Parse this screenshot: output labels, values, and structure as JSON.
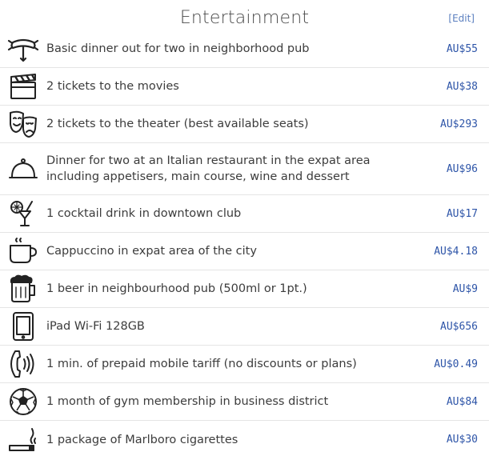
{
  "section": {
    "title": "Entertainment",
    "edit_label": "[Edit]"
  },
  "items": [
    {
      "icon": "sausage-icon",
      "label": "Basic dinner out for two in neighborhood pub",
      "price": "AU$55"
    },
    {
      "icon": "clapperboard-icon",
      "label": "2 tickets to the movies",
      "price": "AU$38"
    },
    {
      "icon": "theater-masks-icon",
      "label": "2 tickets to the theater (best available seats)",
      "price": "AU$293"
    },
    {
      "icon": "cloche-icon",
      "label": "Dinner for two at an Italian restaurant in the expat area including appetisers, main course, wine and dessert",
      "price": "AU$96"
    },
    {
      "icon": "cocktail-icon",
      "label": "1 cocktail drink in downtown club",
      "price": "AU$17"
    },
    {
      "icon": "coffee-cup-icon",
      "label": "Cappuccino in expat area of the city",
      "price": "AU$4.18"
    },
    {
      "icon": "beer-mug-icon",
      "label": "1 beer in neighbourhood pub (500ml or 1pt.)",
      "price": "AU$9"
    },
    {
      "icon": "tablet-icon",
      "label": "iPad Wi-Fi 128GB",
      "price": "AU$656"
    },
    {
      "icon": "phone-handset-icon",
      "label": "1 min. of prepaid mobile tariff (no discounts or plans)",
      "price": "AU$0.49"
    },
    {
      "icon": "soccer-ball-icon",
      "label": "1 month of gym membership in business district",
      "price": "AU$84"
    },
    {
      "icon": "cigarette-icon",
      "label": "1 package of Marlboro cigarettes",
      "price": "AU$30"
    }
  ]
}
